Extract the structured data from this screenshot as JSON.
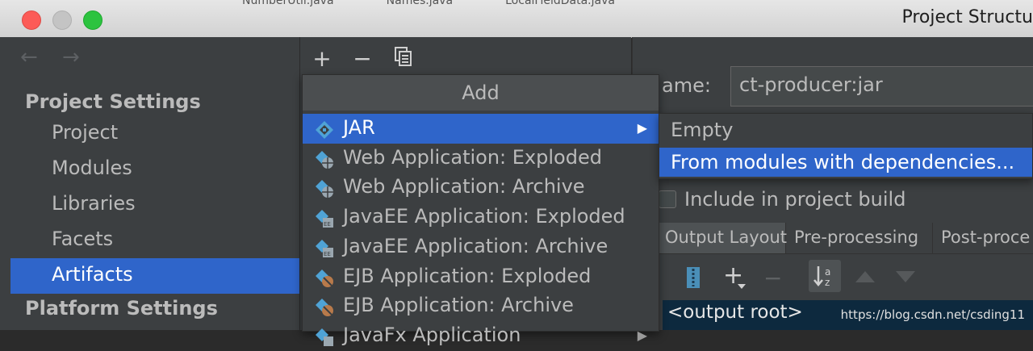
{
  "window": {
    "title": "Project Structu",
    "background_tabs": [
      "NumberUtil.java",
      "Names.java",
      "LocalFieldData.java"
    ]
  },
  "nav": {
    "back_icon": "arrow-left-icon",
    "forward_icon": "arrow-right-icon"
  },
  "sidebar": {
    "project_settings_header": "Project Settings",
    "items": [
      {
        "label": "Project",
        "selected": false
      },
      {
        "label": "Modules",
        "selected": false
      },
      {
        "label": "Libraries",
        "selected": false
      },
      {
        "label": "Facets",
        "selected": false
      },
      {
        "label": "Artifacts",
        "selected": true
      }
    ],
    "platform_settings_header": "Platform Settings"
  },
  "toolbar": {
    "add_label": "+",
    "remove_label": "−",
    "copy_icon": "copy-icon"
  },
  "artifact": {
    "name_label": "ame:",
    "name_value": "ct-producer:jar",
    "include_label": "Include in project build",
    "tabs": [
      "Output Layout",
      "Pre-processing",
      "Post-proce"
    ],
    "output_root": "<output root>"
  },
  "add_popup": {
    "title": "Add",
    "items": [
      {
        "label": "JAR",
        "icon": "jar-icon",
        "selected": true,
        "has_submenu": true
      },
      {
        "label": "Web Application: Exploded",
        "icon": "web-app-icon",
        "selected": false
      },
      {
        "label": "Web Application: Archive",
        "icon": "web-app-icon",
        "selected": false
      },
      {
        "label": "JavaEE Application: Exploded",
        "icon": "javaee-app-icon",
        "selected": false
      },
      {
        "label": "JavaEE Application: Archive",
        "icon": "javaee-app-icon",
        "selected": false
      },
      {
        "label": "EJB Application: Exploded",
        "icon": "ejb-app-icon",
        "selected": false
      },
      {
        "label": "EJB Application: Archive",
        "icon": "ejb-app-icon",
        "selected": false
      },
      {
        "label": "JavaFx Application",
        "icon": "javafx-app-icon",
        "selected": false,
        "has_submenu": true
      }
    ]
  },
  "jar_submenu": {
    "items": [
      {
        "label": "Empty",
        "selected": false
      },
      {
        "label": "From modules with dependencies...",
        "selected": true
      }
    ]
  },
  "watermark": "https://blog.csdn.net/csding11",
  "colors": {
    "selection": "#2f65ca",
    "panel": "#3c3f41",
    "output_root_bg": "#0d293e"
  }
}
